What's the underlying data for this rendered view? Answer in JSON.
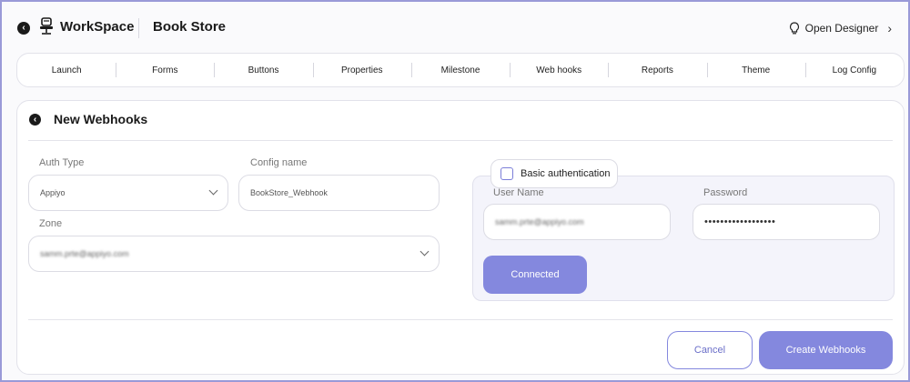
{
  "header": {
    "workspace_label": "WorkSpace",
    "app_name": "Book Store",
    "open_designer_label": "Open Designer",
    "icons": {
      "back": "back-arrow-icon",
      "workspace": "chair-icon",
      "designer": "bulb-icon",
      "chevron": "chevron-right-icon"
    }
  },
  "nav": {
    "items": [
      "Launch",
      "Forms",
      "Buttons",
      "Properties",
      "Milestone",
      "Web hooks",
      "Reports",
      "Theme",
      "Log Config"
    ]
  },
  "form": {
    "title": "New Webhooks",
    "auth_type": {
      "label": "Auth Type",
      "value": "Appiyo"
    },
    "config_name": {
      "label": "Config name",
      "value": "BookStore_Webhook"
    },
    "zone": {
      "label": "Zone",
      "value": "samm.prte@appiyo.com"
    },
    "basic_auth": {
      "label": "Basic authentication",
      "checked": false,
      "username_label": "User Name",
      "username_value": "samm.prte@appiyo.com",
      "password_label": "Password",
      "password_value": "••••••••••••••••••",
      "connected_label": "Connected"
    },
    "actions": {
      "cancel": "Cancel",
      "create": "Create Webhooks"
    }
  },
  "colors": {
    "accent": "#8488de",
    "border": "#9a9ad8",
    "panel": "#f4f4fb"
  }
}
